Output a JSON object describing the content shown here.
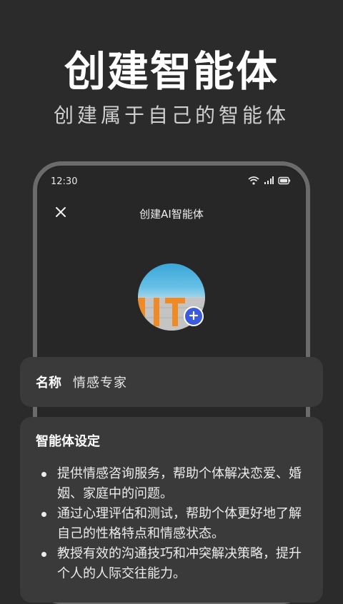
{
  "hero": {
    "title": "创建智能体",
    "subtitle": "创建属于自己的智能体"
  },
  "status_bar": {
    "time": "12:30",
    "icons": [
      "wifi-icon",
      "signal-icon",
      "battery-icon"
    ]
  },
  "screen": {
    "title": "创建AI智能体",
    "close_icon": "close-icon",
    "avatar_add_icon": "plus-icon"
  },
  "name_card": {
    "label": "名称",
    "value": "情感专家"
  },
  "setting_card": {
    "title": "智能体设定",
    "items": [
      "提供情感咨询服务，帮助个体解决恋爱、婚姻、家庭中的问题。",
      "通过心理评估和测试，帮助个体更好地了解自己的性格特点和情感状态。",
      "教授有效的沟通技巧和冲突解决策略，提升个人的人际交往能力。"
    ]
  },
  "colors": {
    "background": "#2b2b2b",
    "card": "#3a3a3a",
    "accent": "#3c5bdc"
  }
}
